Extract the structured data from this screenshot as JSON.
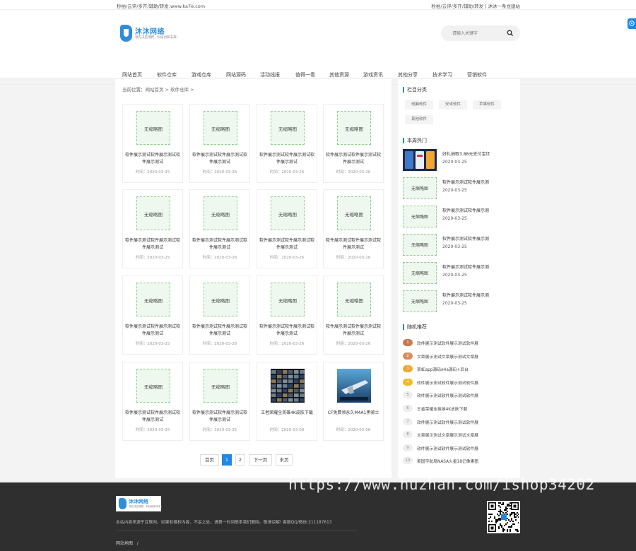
{
  "topbar": {
    "left_text": "秒拍/云评/多开/辅助/转发:www.ka7e.com",
    "right_text": "秒拍/云评/多开/辅助/转发 | 沐沐一条龙建站"
  },
  "header": {
    "logo_name": "沐沐网络",
    "logo_slogan": "领先决定视野，科技创新未来！",
    "search_placeholder": "请输入关键字"
  },
  "nav": [
    "网站首页",
    "软件仓库",
    "游戏仓库",
    "网站源码",
    "活动线报",
    "值得一看",
    "其他资源",
    "游戏资讯",
    "其他分享",
    "技术学习",
    "营销软件"
  ],
  "crumb": {
    "prefix": "当前位置：",
    "home": "网站首页",
    "sep1": ">",
    "current": "软件仓库",
    "sep2": ">"
  },
  "time_label": "时间：",
  "no_thumb_label": "无缩略图",
  "cards": [
    {
      "title": "软件展示测试软件展示测试软件展示测试",
      "date": "2020-03-25",
      "thumb": "none"
    },
    {
      "title": "软件展示测试软件展示测试软件展示测试",
      "date": "2020-03-26",
      "thumb": "none"
    },
    {
      "title": "软件展示测试软件展示测试软件展示测试",
      "date": "2020-03-26",
      "thumb": "none"
    },
    {
      "title": "软件展示测试软件展示测试软件展示测试",
      "date": "2020-03-26",
      "thumb": "none"
    },
    {
      "title": "软件展示测试软件展示测试软件展示测试",
      "date": "2020-03-25",
      "thumb": "none"
    },
    {
      "title": "软件展示测试软件展示测试软件展示测试",
      "date": "2020-03-26",
      "thumb": "none"
    },
    {
      "title": "软件展示测试软件展示测试软件展示测试",
      "date": "2020-03-26",
      "thumb": "none"
    },
    {
      "title": "软件展示测试软件展示测试软件展示测试",
      "date": "2020-03-26",
      "thumb": "none"
    },
    {
      "title": "软件展示测试软件展示测试软件展示测试",
      "date": "2020-03-25",
      "thumb": "none"
    },
    {
      "title": "软件展示测试软件展示测试软件展示测试",
      "date": "2020-03-26",
      "thumb": "none"
    },
    {
      "title": "软件展示测试软件展示测试软件展示测试",
      "date": "2020-03-26",
      "thumb": "none"
    },
    {
      "title": "软件展示测试软件展示测试软件展示测试",
      "date": "2020-03-26",
      "thumb": "none"
    },
    {
      "title": "软件展示测试软件展示测试软件展示测试",
      "date": "2020-03-25",
      "thumb": "none"
    },
    {
      "title": "软件展示测试软件展示测试软件展示测试",
      "date": "2020-03-25",
      "thumb": "none"
    },
    {
      "title": "王者荣耀全英雄4K皮肤下载",
      "date": "2020-03-08",
      "thumb": "screens"
    },
    {
      "title": "CF免费领永久M4A1黑骑士",
      "date": "2020-03-08",
      "thumb": "game"
    }
  ],
  "pagination": {
    "first": "首页",
    "page1": "1",
    "page2": "2",
    "next": "下一页",
    "last": "末页"
  },
  "sidebar": {
    "category_title": "栏目分类",
    "categories": [
      "电脑软件",
      "安卓软件",
      "苹果软件",
      "其他软件"
    ],
    "hot_title": "本周热门",
    "hot": [
      {
        "title": "好礼抽取3.88元支付宝红",
        "date": "2020-03-25",
        "thumb": "phone"
      },
      {
        "title": "软件展示测试软件展示测",
        "date": "2020-03-25",
        "thumb": "none"
      },
      {
        "title": "软件展示测试软件展示测",
        "date": "2020-03-25",
        "thumb": "none"
      },
      {
        "title": "软件展示测试软件展示测",
        "date": "2020-03-25",
        "thumb": "none"
      },
      {
        "title": "软件展示测试软件展示测",
        "date": "2020-03-25",
        "thumb": "none"
      },
      {
        "title": "软件展示测试软件展示测",
        "date": "2020-03-25",
        "thumb": "none"
      }
    ],
    "random_title": "随机推荐",
    "random": [
      {
        "num": "1",
        "title": "软件展示测试软件展示测试软件展"
      },
      {
        "num": "2",
        "title": "文章展示测试文章展示测试文章展"
      },
      {
        "num": "3",
        "title": "某虹app源码e4a源码+后台"
      },
      {
        "num": "4",
        "title": "软件展示测试软件展示测试软件展"
      },
      {
        "num": "5",
        "title": "软件展示测试软件展示测试软件展"
      },
      {
        "num": "6",
        "title": "王者荣耀全英雄4K皮肤下载"
      },
      {
        "num": "7",
        "title": "软件展示测试软件展示测试软件展"
      },
      {
        "num": "8",
        "title": "文章展示测试文章展示测试文章展"
      },
      {
        "num": "9",
        "title": "软件展示测试软件展示测试软件展"
      },
      {
        "num": "10",
        "title": "美国宇航局NASA火星18亿像素图"
      }
    ],
    "rank_colors": [
      "#c87a52",
      "#d88d5c",
      "#f0a830",
      "#f6b823"
    ]
  },
  "footer": {
    "logo_name": "沐沐网络",
    "logo_slogan": "领先决定视野，科技创新未来！",
    "note": "本站内容来源于互联网。如果有侵权内容、不妥之处，请第一时间联系我们删除。敬请谅解! 客服QQ/微信:211187613",
    "links": "网站地图",
    "links_sep": "/",
    "watermark": "https://www.huzhan.com/ishop34202"
  },
  "colors": {
    "accent": "#1e88e5",
    "logo": "#2e8ed8",
    "footer_bg": "#2f2f2f",
    "placeholder_border": "#8fcf8f"
  }
}
